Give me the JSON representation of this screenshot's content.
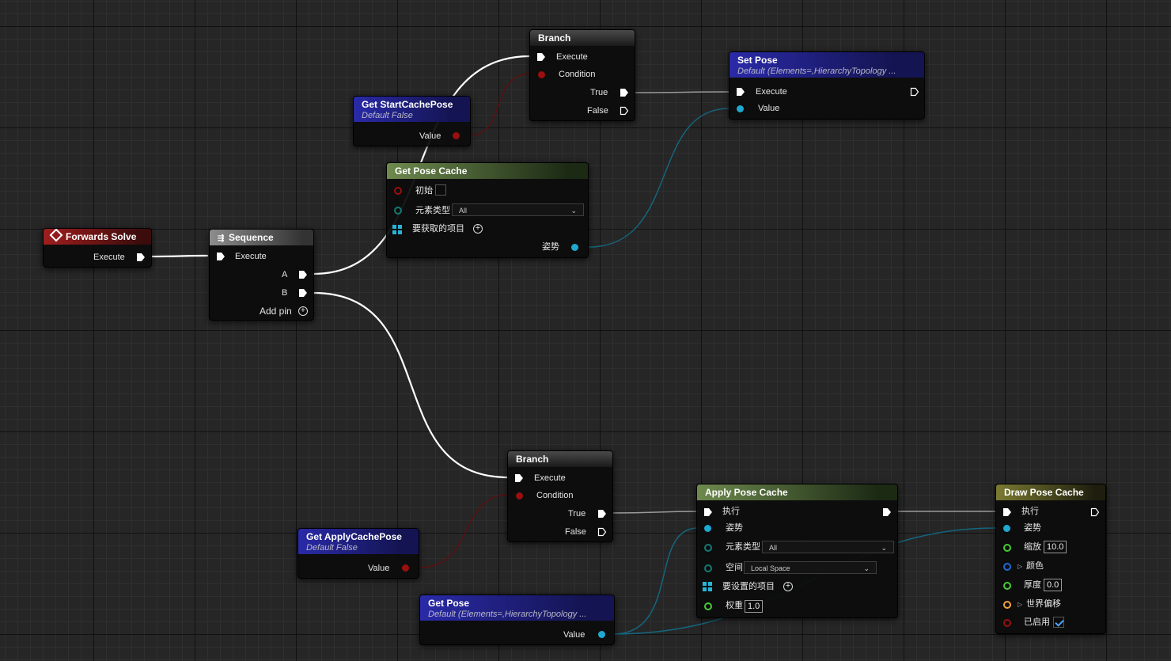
{
  "graph": {
    "forwards_solve": {
      "title": "Forwards Solve",
      "execute": "Execute"
    },
    "sequence": {
      "title": "Sequence",
      "execute": "Execute",
      "a": "A",
      "b": "B",
      "add_pin": "Add pin"
    },
    "branch_top": {
      "title": "Branch",
      "execute": "Execute",
      "condition": "Condition",
      "true": "True",
      "false": "False"
    },
    "branch_bottom": {
      "title": "Branch",
      "execute": "Execute",
      "condition": "Condition",
      "true": "True",
      "false": "False"
    },
    "get_start_cache_pose": {
      "title": "Get StartCachePose",
      "subtitle": "Default False",
      "value": "Value"
    },
    "get_apply_cache_pose": {
      "title": "Get ApplyCachePose",
      "subtitle": "Default False",
      "value": "Value"
    },
    "set_pose": {
      "title": "Set Pose",
      "subtitle": "Default (Elements=,HierarchyTopology ...",
      "execute": "Execute",
      "value": "Value"
    },
    "get_pose": {
      "title": "Get Pose",
      "subtitle": "Default (Elements=,HierarchyTopology ...",
      "value": "Value"
    },
    "get_pose_cache": {
      "title": "Get Pose Cache",
      "initial": "初始",
      "element_type": "元素类型",
      "element_type_value": "All",
      "items_to_get": "要获取的项目",
      "pose": "姿势"
    },
    "apply_pose_cache": {
      "title": "Apply Pose Cache",
      "execute": "执行",
      "pose": "姿势",
      "element_type": "元素类型",
      "element_type_value": "All",
      "space": "空间",
      "space_value": "Local Space",
      "items_to_set": "要设置的项目",
      "weight": "权重",
      "weight_value": "1.0"
    },
    "draw_pose_cache": {
      "title": "Draw Pose Cache",
      "execute": "执行",
      "pose": "姿势",
      "scale": "缩放",
      "scale_value": "10.0",
      "color": "颜色",
      "thickness": "厚度",
      "thickness_value": "0.0",
      "world_offset": "世界偏移",
      "enabled": "已启用",
      "enabled_checked": true
    }
  },
  "colors": {
    "exec": "#ffffff",
    "bool": "#9a0f0f",
    "pose": "#1fa8d0",
    "float": "#44cc33",
    "vector": "#f0a040",
    "color": "#1e6ad6",
    "enum": "#127a75"
  }
}
